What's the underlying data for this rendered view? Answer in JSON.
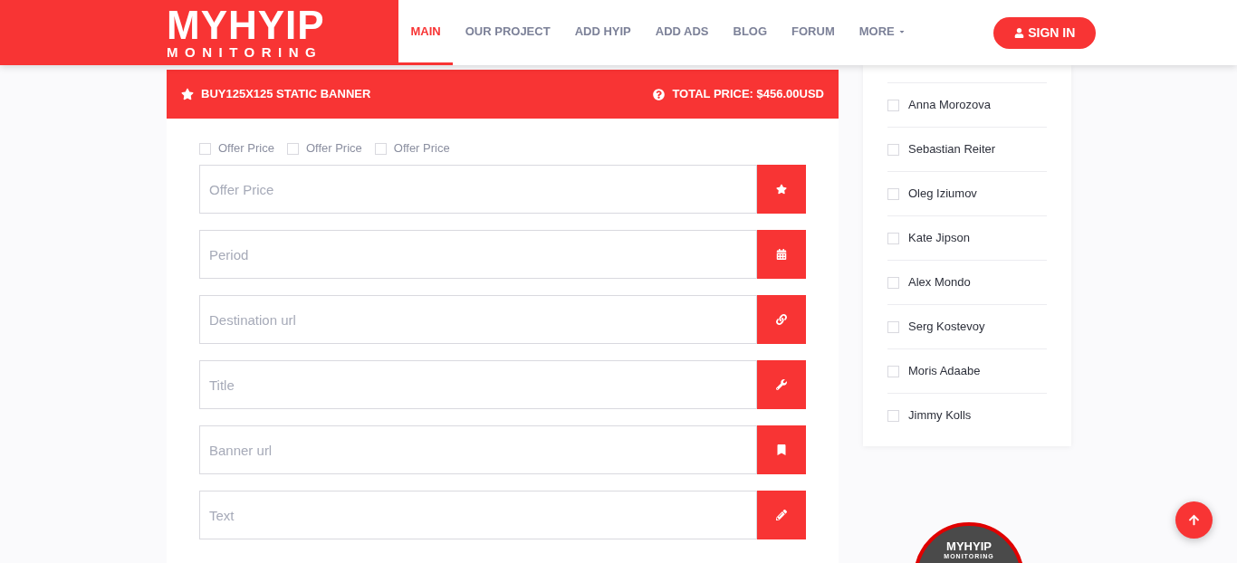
{
  "header": {
    "logo": {
      "title": "MYHYIP",
      "subtitle": "MONITORING"
    },
    "nav": [
      {
        "label": "MAIN",
        "selected": true,
        "dropdown": false
      },
      {
        "label": "OUR PROJECT",
        "selected": false,
        "dropdown": false
      },
      {
        "label": "ADD HYIP",
        "selected": false,
        "dropdown": false
      },
      {
        "label": "ADD ADS",
        "selected": false,
        "dropdown": false
      },
      {
        "label": "BLOG",
        "selected": false,
        "dropdown": false
      },
      {
        "label": "FORUM",
        "selected": false,
        "dropdown": false
      },
      {
        "label": "MORE",
        "selected": false,
        "dropdown": true
      }
    ],
    "sign_in": "SIGN IN"
  },
  "form": {
    "title": "BUY125X125 STATIC BANNER",
    "total": "TOTAL PRICE: $456.00USD",
    "options": [
      {
        "label": "Offer Price",
        "checked": false
      },
      {
        "label": "Offer Price",
        "checked": false
      },
      {
        "label": "Offer Price",
        "checked": false
      }
    ],
    "fields": [
      {
        "placeholder": "Offer Price",
        "kind": "star"
      },
      {
        "placeholder": "Period",
        "kind": "calendar"
      },
      {
        "placeholder": "Destination url",
        "kind": "link"
      },
      {
        "placeholder": "Title",
        "kind": "wrench"
      },
      {
        "placeholder": "Banner url",
        "kind": "bookmark"
      },
      {
        "placeholder": "Text",
        "kind": "pencil"
      }
    ]
  },
  "sidebar": {
    "users": [
      {
        "name": "Anna Morozova",
        "checked": false
      },
      {
        "name": "Sebastian Reiter",
        "checked": false
      },
      {
        "name": "Oleg Iziumov",
        "checked": false
      },
      {
        "name": "Kate Jipson",
        "checked": false
      },
      {
        "name": "Alex Mondo",
        "checked": false
      },
      {
        "name": "Serg Kostevoy",
        "checked": false
      },
      {
        "name": "Moris Adaabe",
        "checked": false
      },
      {
        "name": "Jimmy Kolls",
        "checked": false
      }
    ],
    "badge": {
      "title": "MYHYIP",
      "subtitle": "MONITORING"
    }
  }
}
